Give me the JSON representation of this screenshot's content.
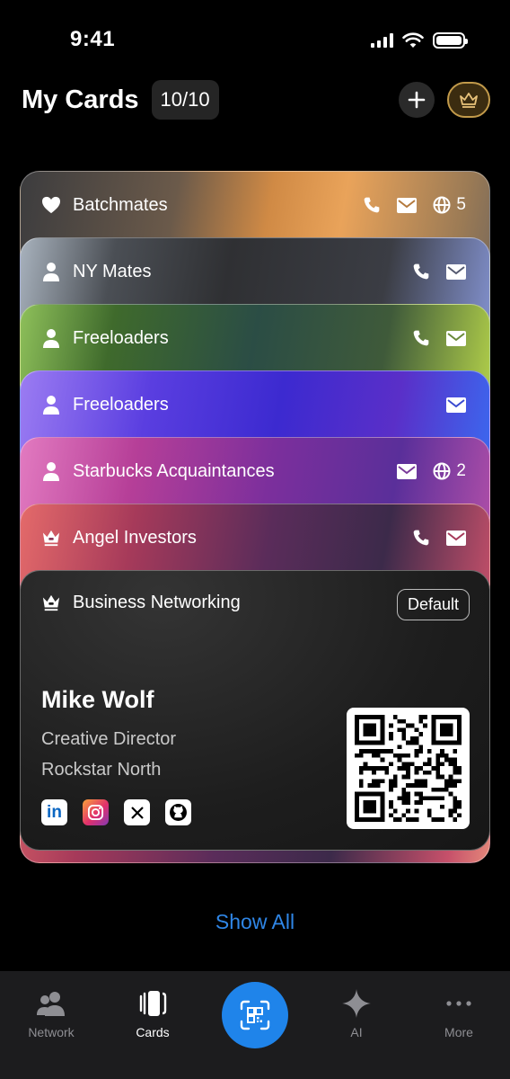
{
  "status": {
    "time": "9:41"
  },
  "header": {
    "title": "My Cards",
    "count": "10/10",
    "add_icon": "plus-icon",
    "premium_icon": "crown-icon"
  },
  "colors": {
    "accent": "#1f84ea",
    "link": "#2f86e6",
    "premium_border": "#c29a4a"
  },
  "cards": [
    {
      "name": "Batchmates",
      "icon": "heart-icon",
      "phone": true,
      "mail": true,
      "web_count": "5"
    },
    {
      "name": "NY Mates",
      "icon": "person-icon",
      "phone": true,
      "mail": true,
      "web_count": null
    },
    {
      "name": "Freeloaders",
      "icon": "person-icon",
      "phone": true,
      "mail": true,
      "web_count": null
    },
    {
      "name": "Freeloaders",
      "icon": "person-icon",
      "phone": false,
      "mail": true,
      "web_count": null
    },
    {
      "name": "Starbucks Acquaintances",
      "icon": "person-icon",
      "phone": false,
      "mail": true,
      "web_count": "2"
    },
    {
      "name": "Angel Investors",
      "icon": "crown-icon",
      "phone": true,
      "mail": true,
      "web_count": null
    }
  ],
  "active_card": {
    "name": "Business Networking",
    "icon": "crown-icon",
    "badge": "Default",
    "person": {
      "name": "Mike Wolf",
      "title": "Creative Director",
      "company": "Rockstar North"
    },
    "socials": [
      "linkedin-icon",
      "instagram-icon",
      "x-icon",
      "github-icon"
    ]
  },
  "show_all": "Show All",
  "tabbar": {
    "items": [
      {
        "label": "Network",
        "icon": "people-icon",
        "active": false
      },
      {
        "label": "Cards",
        "icon": "cards-icon",
        "active": true
      },
      {
        "label": "",
        "icon": "qr-scan-icon",
        "active": false
      },
      {
        "label": "AI",
        "icon": "sparkle-icon",
        "active": false
      },
      {
        "label": "More",
        "icon": "ellipsis-icon",
        "active": false
      }
    ]
  }
}
